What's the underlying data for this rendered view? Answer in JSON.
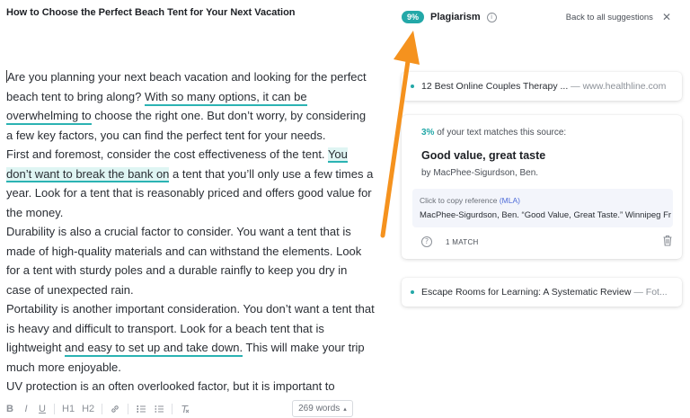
{
  "document": {
    "title": "How to Choose the Perfect Beach Tent for Your Next Vacation",
    "paragraphs": [
      [
        {
          "text": "Are you planning your next beach vacation and looking for the perfect beach tent to bring along? "
        },
        {
          "text": "With so many options, it can be overwhelming to",
          "hl": "u"
        },
        {
          "text": " choose the right one. But don’t worry, by considering a few key factors, you can find the perfect tent for your needs."
        }
      ],
      [
        {
          "text": "First and foremost, consider the cost effectiveness of the tent. "
        },
        {
          "text": "You don’t want to break the bank on",
          "hl": "bg"
        },
        {
          "text": " a tent that you’ll only use a few times a year. Look for a tent that is reasonably priced and offers good value for the money."
        }
      ],
      [
        {
          "text": "Durability is also a crucial factor to consider. You want a tent that is made of high-quality materials and can withstand the elements. Look for a tent with sturdy poles and a durable rainfly to keep you dry in case of unexpected rain."
        }
      ],
      [
        {
          "text": "Portability is another important consideration. You don’t want a tent that is heavy and difficult to transport. Look for a beach tent that is lightweight "
        },
        {
          "text": "and easy to set up and take down.",
          "hl": "u"
        },
        {
          "text": " This will make your trip much more enjoyable."
        }
      ],
      [
        {
          "text": "UV protection is an often overlooked factor, but it is important to consider."
        }
      ]
    ]
  },
  "toolbar": {
    "bold": "B",
    "italic": "I",
    "underline": "U",
    "h1": "H1",
    "h2": "H2",
    "word_count": "269 words",
    "word_count_caret": "▴"
  },
  "panel": {
    "badge": "9%",
    "title": "Plagiarism",
    "info_glyph": "i",
    "back_link": "Back to all suggestions",
    "close_glyph": "✕"
  },
  "sources": {
    "first": {
      "title": "12 Best Online Couples Therapy ...",
      "separator": " — ",
      "domain": "www.healthline.com"
    },
    "active": {
      "match_pct": "3%",
      "match_text": " of your text matches this source:",
      "title": "Good value, great taste",
      "author": "by MacPhee-Sigurdson, Ben.",
      "ref_label": "Click to copy reference ",
      "ref_style": "(MLA)",
      "ref_text": "MacPhee-Sigurdson, Ben. “Good Value, Great Taste.” Winnipeg Free Press",
      "help_glyph": "?",
      "match_count": "1 MATCH"
    },
    "third": {
      "title": "Escape Rooms for Learning: A Systematic Review",
      "separator": " — ",
      "domain": "Fot..."
    }
  },
  "colors": {
    "accent": "#23a8a8",
    "highlight_bg": "#dff5f3",
    "arrow": "#f5921e",
    "mla_link": "#4d6bd8"
  }
}
